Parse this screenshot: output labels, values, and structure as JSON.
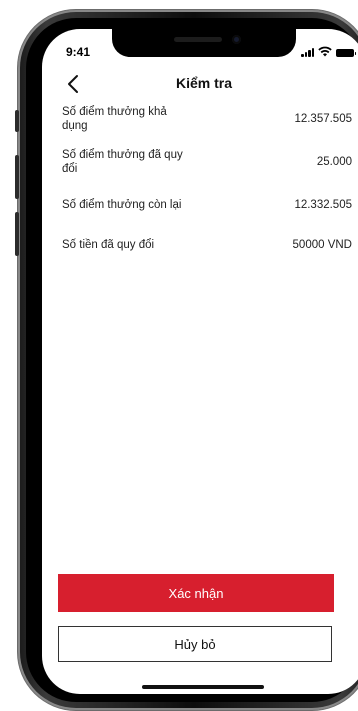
{
  "status_bar": {
    "time": "9:41"
  },
  "header": {
    "title": "Kiểm tra",
    "back_icon": "chevron-left-icon"
  },
  "details": [
    {
      "label": "Số điểm thưởng khả dụng",
      "value": "12.357.505"
    },
    {
      "label": "Số điểm thưởng đã quy đổi",
      "value": "25.000"
    },
    {
      "label": "Số điểm thưởng còn lại",
      "value": "12.332.505"
    },
    {
      "label": "Số tiền đã quy đổi",
      "value": "50000 VND"
    }
  ],
  "actions": {
    "confirm_label": "Xác nhận",
    "cancel_label": "Hủy bỏ"
  },
  "colors": {
    "primary": "#d71f2e",
    "text": "#222222",
    "background": "#ffffff"
  }
}
